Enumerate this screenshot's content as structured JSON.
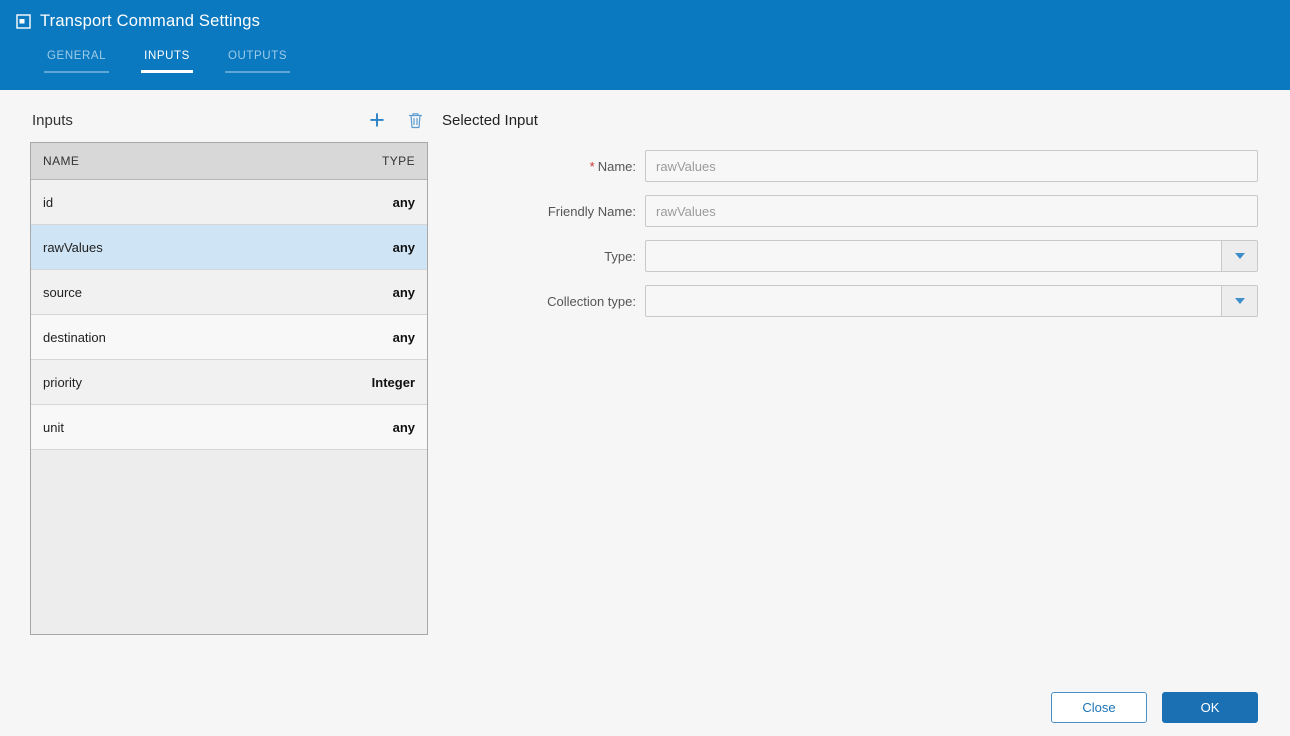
{
  "header": {
    "title": "Transport Command Settings",
    "tabs": [
      {
        "label": "GENERAL",
        "active": false
      },
      {
        "label": "INPUTS",
        "active": true
      },
      {
        "label": "OUTPUTS",
        "active": false
      }
    ]
  },
  "inputs_panel": {
    "title": "Inputs",
    "columns": [
      "NAME",
      "TYPE"
    ],
    "rows": [
      {
        "name": "id",
        "type": "any",
        "selected": false
      },
      {
        "name": "rawValues",
        "type": "any",
        "selected": true
      },
      {
        "name": "source",
        "type": "any",
        "selected": false
      },
      {
        "name": "destination",
        "type": "any",
        "selected": false
      },
      {
        "name": "priority",
        "type": "Integer",
        "selected": false
      },
      {
        "name": "unit",
        "type": "any",
        "selected": false
      }
    ]
  },
  "selected_input": {
    "title": "Selected Input",
    "required_marker": "*",
    "fields": [
      {
        "label": "Name:",
        "required": true,
        "value": "rawValues",
        "type": "text"
      },
      {
        "label": "Friendly Name:",
        "required": false,
        "value": "rawValues",
        "type": "text"
      },
      {
        "label": "Type:",
        "required": false,
        "value": "",
        "type": "select"
      },
      {
        "label": "Collection type:",
        "required": false,
        "value": "",
        "type": "select"
      }
    ]
  },
  "footer": {
    "close_label": "Close",
    "ok_label": "OK"
  },
  "colors": {
    "header_blue": "#0b79c0",
    "accent_blue": "#1b6fb3",
    "selected_row": "#cfe4f4",
    "required_red": "#c9302c"
  }
}
